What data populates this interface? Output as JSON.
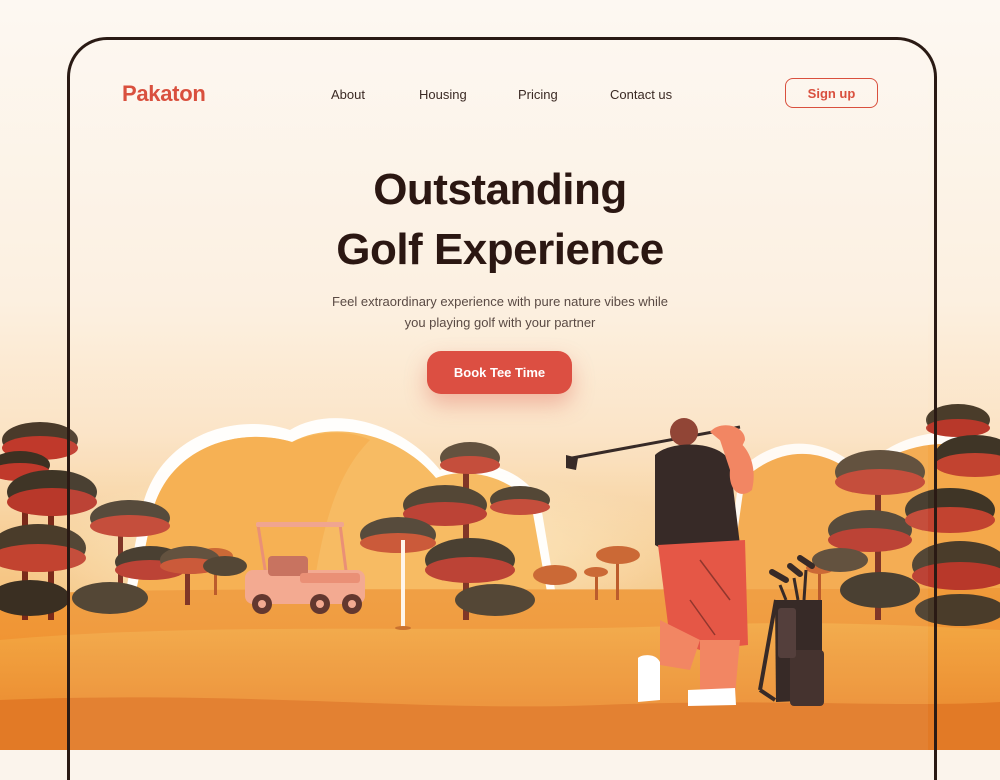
{
  "brand": {
    "logo_text": "Pakaton"
  },
  "nav": {
    "items": [
      {
        "label": "About"
      },
      {
        "label": "Housing"
      },
      {
        "label": "Pricing"
      },
      {
        "label": "Contact us"
      }
    ],
    "signup_label": "Sign up"
  },
  "hero": {
    "title_line1": "Outstanding",
    "title_line2": "Golf Experience",
    "subtitle_line1": "Feel extraordinary experience with pure nature vibes while",
    "subtitle_line2": "you playing golf with your partner",
    "cta_label": "Book Tee Time"
  },
  "colors": {
    "accent": "#dc4f42",
    "heading": "#2b1712",
    "frame": "#2a1a14"
  }
}
